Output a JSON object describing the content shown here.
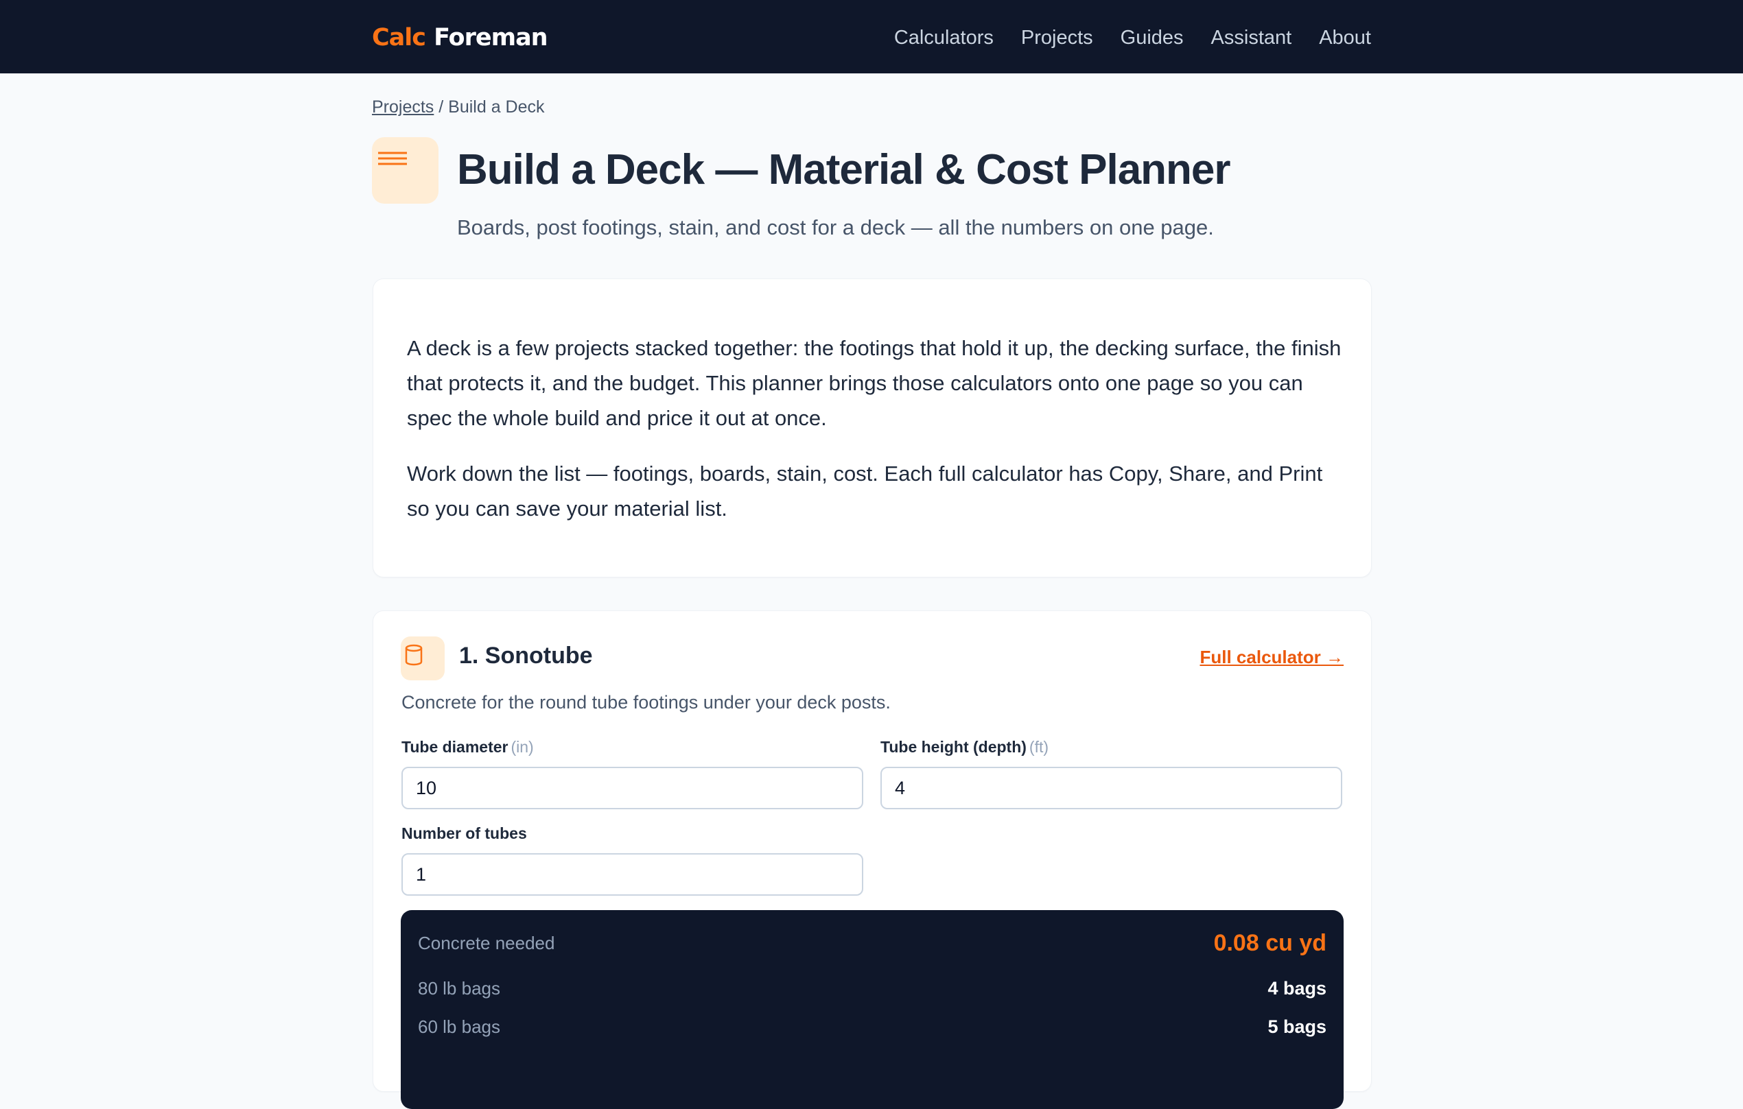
{
  "brand": {
    "part1": "Calc",
    "part2": "Foreman"
  },
  "nav": [
    "Calculators",
    "Projects",
    "Guides",
    "Assistant",
    "About"
  ],
  "breadcrumb": {
    "parent": "Projects",
    "separator": "/",
    "current": "Build a Deck"
  },
  "page": {
    "icon": "menu-lines-icon",
    "title": "Build a Deck — Material & Cost Planner",
    "subtitle": "Boards, post footings, stain, and cost for a deck — all the numbers on one page."
  },
  "intro": {
    "paragraphs": [
      "A deck is a few projects stacked together: the footings that hold it up, the decking surface, the finish that protects it, and the budget. This planner brings those calculators onto one page so you can spec the whole build and price it out at once.",
      "Work down the list — footings, boards, stain, cost. Each full calculator has Copy, Share, and Print so you can save your material list."
    ]
  },
  "sections": [
    {
      "icon": "cylinder-icon",
      "title": "1. Sonotube",
      "link": "Full calculator →",
      "description": "Concrete for the round tube footings under your deck posts.",
      "fields": [
        {
          "label": "Tube diameter",
          "unit": "(in)",
          "value": "10"
        },
        {
          "label": "Tube height (depth)",
          "unit": "(ft)",
          "value": "4"
        },
        {
          "label": "Number of tubes",
          "unit": "",
          "value": "1"
        }
      ],
      "results": [
        {
          "label": "Concrete needed",
          "value": "0.08 cu yd"
        },
        {
          "label": "80 lb bags",
          "value": "4 bags"
        },
        {
          "label": "60 lb bags",
          "value": "5 bags"
        }
      ]
    }
  ],
  "colors": {
    "accent": "#f97316",
    "navbar": "#0f172a",
    "icon_bg": "#ffedd5",
    "page_bg": "#f8fafc"
  }
}
